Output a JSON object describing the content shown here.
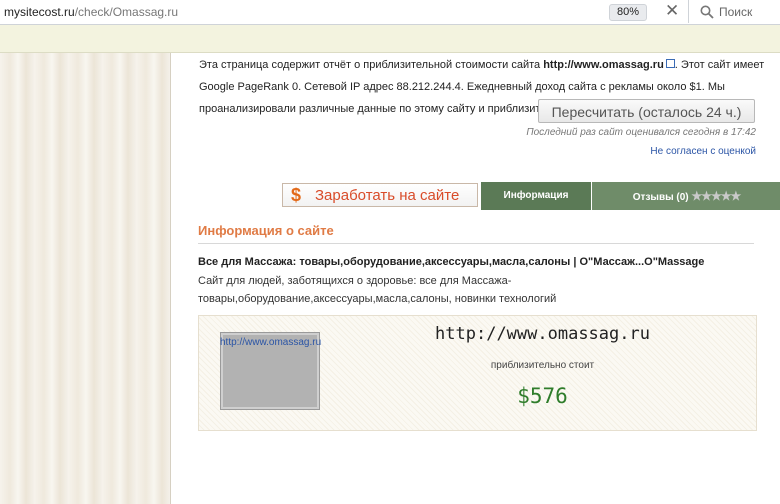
{
  "browser": {
    "url_domain": "mysitecost.ru",
    "url_path": "/check/Omassag.ru",
    "zoom": "80%",
    "close_glyph": "✕",
    "search_placeholder": "Поиск"
  },
  "intro": {
    "text_1": "Эта страница содержит отчёт о приблизительной стоимости сайта ",
    "site_link": "http://www.omassag.ru",
    "text_2": ". Этот сайт имеет Google PageRank 0. Сетевой IP адрес 88.212.244.4. Ежедневный доход сайта с рекламы около $1. Мы проанализировали различные данные по этому сайту и приблизит"
  },
  "recalc_button": "Пересчитать (осталось 24 ч.)",
  "last_evaluated": "Последний раз сайт оценивался сегодня в 17:42",
  "disagree_link": "Не согласен с оценкой",
  "earn_button": {
    "icon": "$",
    "label": "Заработать на сайте"
  },
  "tabs": {
    "info": "Информация",
    "reviews": "Отзывы (0)",
    "stars": "★★★★★"
  },
  "section": {
    "title": "Информация о сайте",
    "site_title": "Все для Массажа: товары,оборудование,аксессуары,масла,салоны | О\"Массаж...О\"Massage",
    "site_desc": "Сайт для людей, заботящихся о здоровье: все для Массажа-товары,оборудование,аксессуары,масла,салоны, новинки технологий"
  },
  "card": {
    "thumb_link": "http://www.omassag.ru",
    "url": "http://www.omassag.ru",
    "cost_label": "приблизительно стоит",
    "price": "$576"
  }
}
